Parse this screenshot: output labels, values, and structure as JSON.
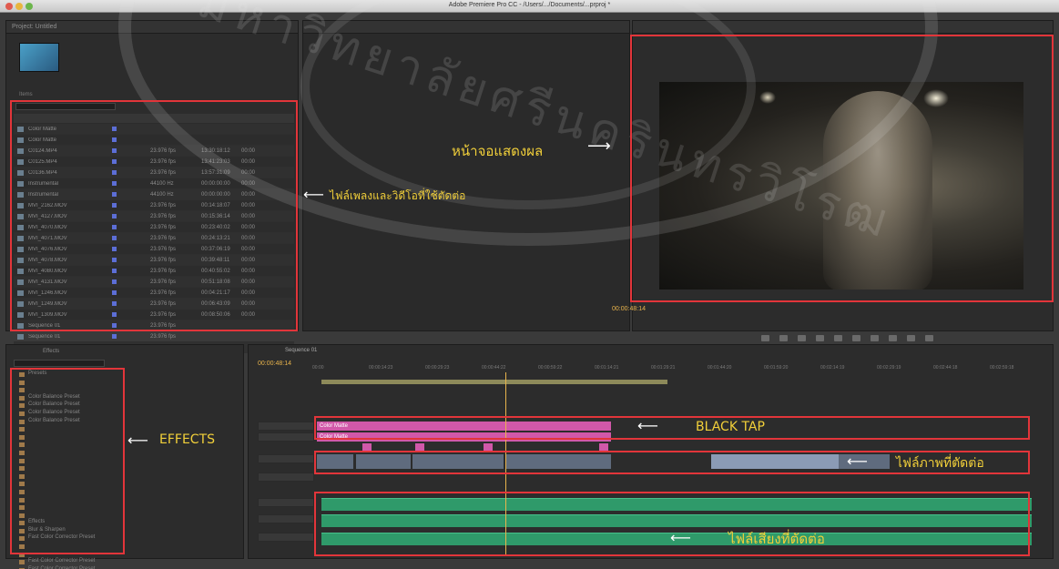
{
  "window": {
    "title": "Adobe Premiere Pro CC - /Users/.../Documents/...prproj *"
  },
  "project_panel": {
    "tab": "Project: Untitled",
    "item_count": "Items",
    "files": [
      {
        "name": "Color Matte",
        "c1": "",
        "c2": "",
        "c3": ""
      },
      {
        "name": "Color Matte",
        "c1": "",
        "c2": "",
        "c3": ""
      },
      {
        "name": "C0124.MP4",
        "c1": "23.976 fps",
        "c2": "13:30:18:12",
        "c3": "00:00"
      },
      {
        "name": "C0125.MP4",
        "c1": "23.976 fps",
        "c2": "13:41:23:03",
        "c3": "00:00"
      },
      {
        "name": "C0136.MP4",
        "c1": "23.976 fps",
        "c2": "13:57:31:09",
        "c3": "00:00"
      },
      {
        "name": "Instrumental",
        "c1": "44100 Hz",
        "c2": "00:00:00:00",
        "c3": "00:00"
      },
      {
        "name": "Instrumental",
        "c1": "44100 Hz",
        "c2": "00:00:00:00",
        "c3": "00:00"
      },
      {
        "name": "MVI_2162.MOV",
        "c1": "23.976 fps",
        "c2": "00:14:18:07",
        "c3": "00:00"
      },
      {
        "name": "MVI_4127.MOV",
        "c1": "23.976 fps",
        "c2": "00:15:36:14",
        "c3": "00:00"
      },
      {
        "name": "MVI_4070.MOV",
        "c1": "23.976 fps",
        "c2": "00:23:40:02",
        "c3": "00:00"
      },
      {
        "name": "MVI_4071.MOV",
        "c1": "23.976 fps",
        "c2": "00:24:13:21",
        "c3": "00:00"
      },
      {
        "name": "MVI_4076.MOV",
        "c1": "23.976 fps",
        "c2": "00:37:06:19",
        "c3": "00:00"
      },
      {
        "name": "MVI_4078.MOV",
        "c1": "23.976 fps",
        "c2": "00:39:48:11",
        "c3": "00:00"
      },
      {
        "name": "MVI_4080.MOV",
        "c1": "23.976 fps",
        "c2": "00:40:55:02",
        "c3": "00:00"
      },
      {
        "name": "MVI_4131.MOV",
        "c1": "23.976 fps",
        "c2": "00:51:18:08",
        "c3": "00:00"
      },
      {
        "name": "MVI_1246.MOV",
        "c1": "23.976 fps",
        "c2": "00:04:21:17",
        "c3": "00:00"
      },
      {
        "name": "MVI_1249.MOV",
        "c1": "23.976 fps",
        "c2": "00:06:43:09",
        "c3": "00:00"
      },
      {
        "name": "MVI_1309.MOV",
        "c1": "23.976 fps",
        "c2": "00:08:50:06",
        "c3": "00:00"
      },
      {
        "name": "Sequence 01",
        "c1": "23.976 fps",
        "c2": "",
        "c3": ""
      },
      {
        "name": "Sequence 01",
        "c1": "23.976 fps",
        "c2": "",
        "c3": ""
      },
      {
        "name": "Sequence 01",
        "c1": "23.976 fps",
        "c2": "",
        "c3": ""
      }
    ]
  },
  "program_monitor": {
    "timecode": "00:00:48:14"
  },
  "effects_panel": {
    "tab": "Effects",
    "items": [
      "Presets",
      "",
      "",
      "Color Balance Preset",
      "Color Balance Preset",
      "Color Balance Preset",
      "Color Balance Preset",
      "",
      "",
      "",
      "",
      "",
      "",
      "",
      "",
      "",
      "",
      "",
      "",
      "Effects",
      "Blur & Sharpen",
      "Fast Color Corrector Preset",
      "",
      "",
      "Fast Color Corrector Preset",
      "Fast Color Corrector Preset",
      "Fast Color Corrector Preset"
    ]
  },
  "timeline": {
    "tab": "Sequence 01",
    "timecode": "00:00:48:14",
    "ruler": [
      "00:00",
      "00:00:14:23",
      "00:00:29:23",
      "00:00:44:22",
      "00:00:59:22",
      "00:01:14:21",
      "00:01:29:21",
      "00:01:44:20",
      "00:01:59:20",
      "00:02:14:19",
      "00:02:29:19",
      "00:02:44:18",
      "00:02:59:18"
    ],
    "pink_clip_1": "Color Matte",
    "pink_clip_2": "Color Matte"
  },
  "annotations": {
    "project": "ไฟล์เพลงและวิดีโอที่ใช้ตัดต่อ",
    "monitor": "หน้าจอแสดงผล",
    "effects": "EFFECTS",
    "black_tap": "BLACK TAP",
    "video_track": "ไฟล์ภาพที่ตัดต่อ",
    "audio_track": "ไฟล์เสียงที่ตัดต่อ",
    "text_color": "#f2d03a",
    "box_color": "#e2353a"
  },
  "watermark": {
    "text": "มหาวิทยาลัยศรีนครินทรวิโรฒ"
  }
}
